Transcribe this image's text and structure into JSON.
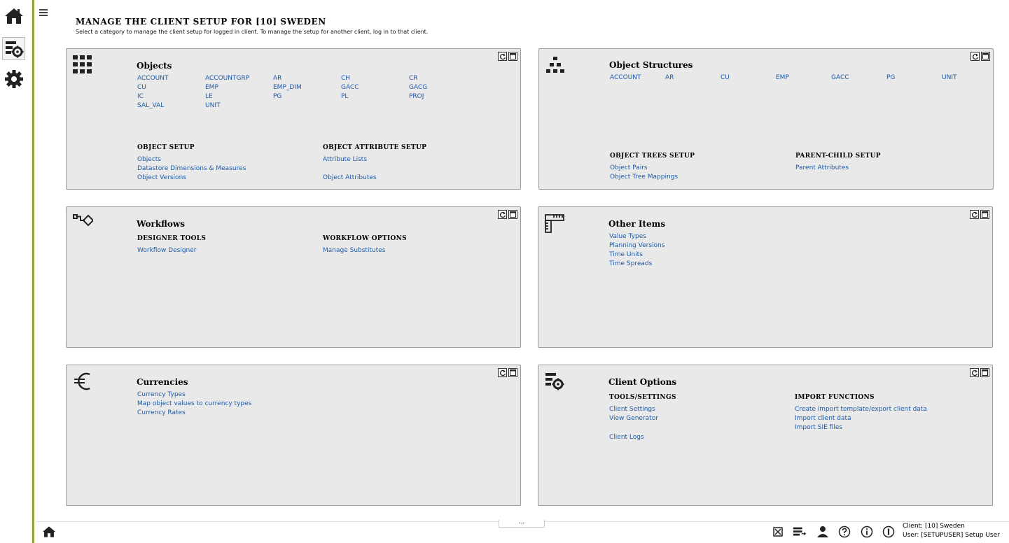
{
  "header": {
    "title": "MANAGE THE CLIENT SETUP FOR [10] SWEDEN",
    "subtitle": "Select a category to manage the client setup for logged in client. To manage the setup for another client, log in to that client."
  },
  "sidebar": {
    "items": [
      {
        "icon": "home-icon"
      },
      {
        "icon": "client-setup-icon"
      },
      {
        "icon": "gear-icon"
      }
    ]
  },
  "panels": {
    "objects": {
      "title": "Objects",
      "codes": [
        "ACCOUNT",
        "ACCOUNTGRP",
        "AR",
        "CH",
        "CR",
        "CU",
        "EMP",
        "EMP_DIM",
        "GACC",
        "GACG",
        "IC",
        "LE",
        "PG",
        "PL",
        "PROJ",
        "SAL_VAL",
        "UNIT"
      ],
      "object_setup": {
        "title": "OBJECT SETUP",
        "links": [
          "Objects",
          "Datastore Dimensions & Measures",
          "Object Versions"
        ]
      },
      "attribute_setup": {
        "title": "OBJECT ATTRIBUTE SETUP",
        "links": [
          "Attribute Lists",
          "Object Attributes"
        ]
      }
    },
    "structures": {
      "title": "Object Structures",
      "codes": [
        "ACCOUNT",
        "AR",
        "CU",
        "EMP",
        "GACC",
        "PG",
        "UNIT"
      ],
      "trees_setup": {
        "title": "OBJECT TREES SETUP",
        "links": [
          "Object Pairs",
          "Object Tree Mappings"
        ]
      },
      "parent_child": {
        "title": "PARENT-CHILD SETUP",
        "links": [
          "Parent Attributes"
        ]
      }
    },
    "workflows": {
      "title": "Workflows",
      "designer": {
        "title": "DESIGNER TOOLS",
        "links": [
          "Workflow Designer"
        ]
      },
      "options": {
        "title": "WORKFLOW OPTIONS",
        "links": [
          "Manage Substitutes"
        ]
      }
    },
    "other": {
      "title": "Other Items",
      "links": [
        "Value Types",
        "Planning Versions",
        "Time Units",
        "Time Spreads"
      ]
    },
    "currencies": {
      "title": "Currencies",
      "links": [
        "Currency Types",
        "Map object values to currency types",
        "Currency Rates"
      ]
    },
    "client_options": {
      "title": "Client Options",
      "tools": {
        "title": "TOOLS/SETTINGS",
        "links": [
          "Client Settings",
          "View Generator",
          "Client Logs"
        ]
      },
      "import": {
        "title": "IMPORT FUNCTIONS",
        "links": [
          "Create import template/export client data",
          "Import client data",
          "Import SIE files"
        ]
      }
    }
  },
  "footer": {
    "more_label": "...",
    "client_line": "Client: [10] Sweden",
    "user_line": "User: [SETUPUSER] Setup User"
  },
  "colors": {
    "accent": "#8fa53a",
    "link": "#1e5aa8",
    "panel_bg": "#e9e9e9"
  }
}
